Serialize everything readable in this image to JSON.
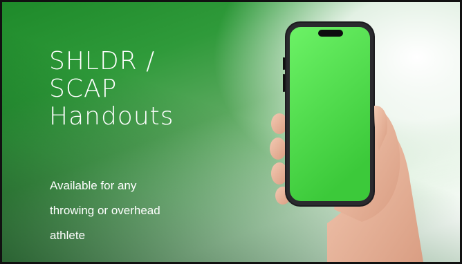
{
  "slide": {
    "title_lines": [
      "SHLDR /",
      "SCAP",
      "Handouts"
    ],
    "subtitle_lines": [
      "Available for any",
      "throwing or overhead",
      "athlete"
    ]
  },
  "colors": {
    "accent_green": "#1e8a2a",
    "phone_screen": "#5ee65a",
    "text": "#ffffff"
  },
  "icons": {
    "phone": "smartphone-icon",
    "hand": "hand-holding-phone"
  }
}
